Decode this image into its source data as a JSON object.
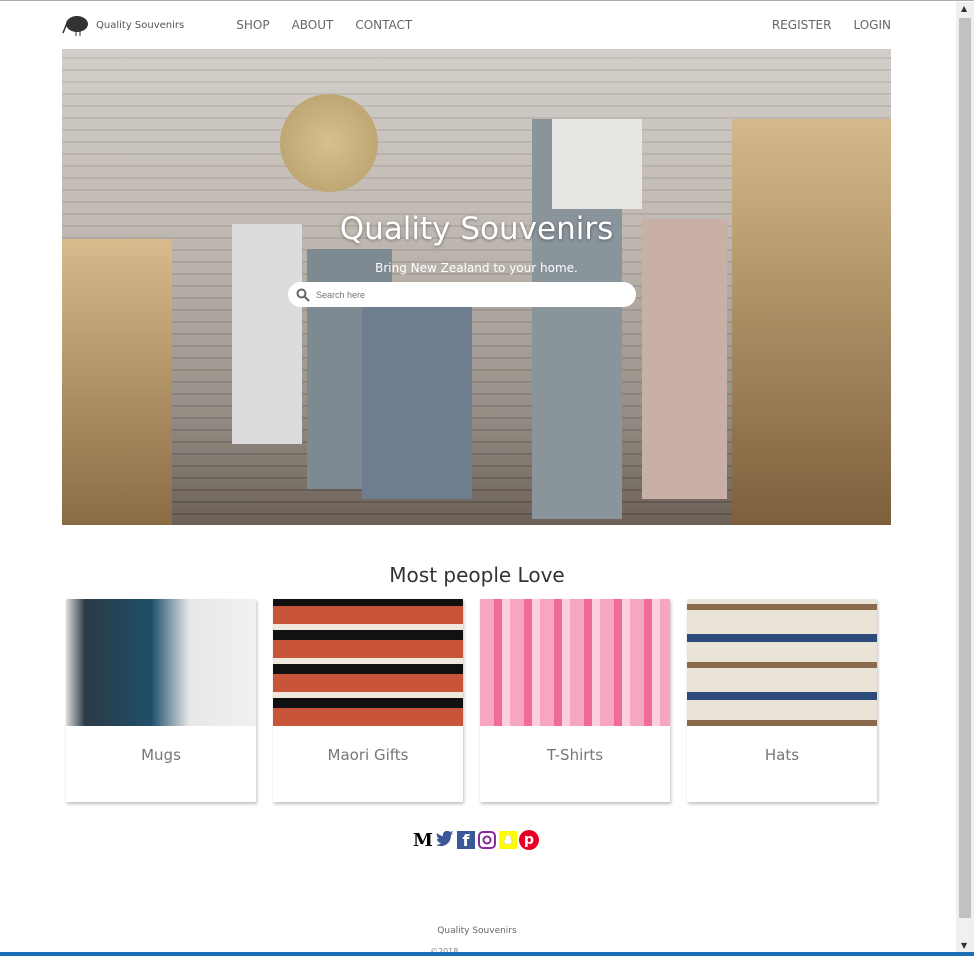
{
  "nav": {
    "brand": "Quality Souvenirs",
    "links": [
      "SHOP",
      "ABOUT",
      "CONTACT"
    ],
    "right": [
      "REGISTER",
      "LOGIN"
    ]
  },
  "hero": {
    "title": "Quality Souvenirs",
    "subtitle": "Bring New Zealand to your home.",
    "search_placeholder": "Search here"
  },
  "section": {
    "title": "Most people Love",
    "cards": [
      {
        "label": "Mugs"
      },
      {
        "label": "Maori Gifts"
      },
      {
        "label": "T-Shirts"
      },
      {
        "label": "Hats"
      }
    ]
  },
  "social": {
    "medium": "M",
    "colors": {
      "twitter": "#3b5998",
      "facebook": "#3b5998",
      "instagram": "#8a2a9b",
      "snapchat": "#fffc00",
      "pinterest": "#e60023"
    }
  },
  "footer": {
    "brand": "Quality Souvenirs",
    "copyright": "©2018"
  }
}
